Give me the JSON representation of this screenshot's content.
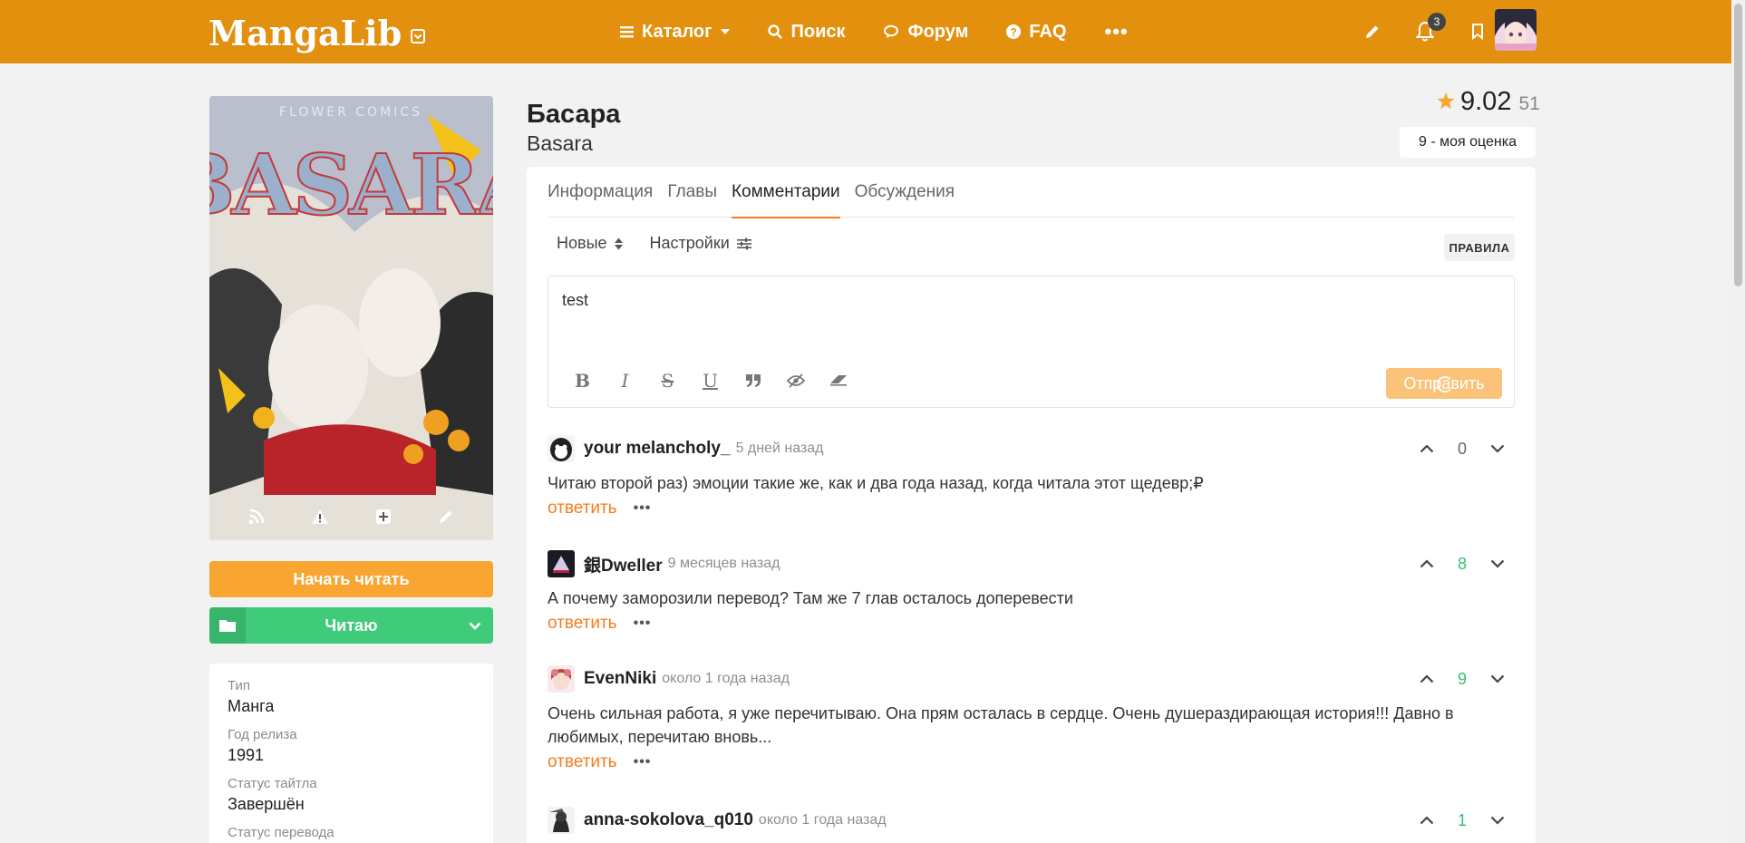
{
  "header": {
    "logo_text": "MangaLib",
    "nav": [
      {
        "label": "Каталог",
        "icon": "menu-icon"
      },
      {
        "label": "Поиск",
        "icon": "search-icon"
      },
      {
        "label": "Форум",
        "icon": "chat-icon"
      },
      {
        "label": "FAQ",
        "icon": "help-icon"
      }
    ],
    "more": "•••",
    "notifications_count": "3"
  },
  "manga": {
    "title_ru": "Басара",
    "title_en": "Basara",
    "rating": "9.02",
    "rating_count": "51",
    "my_rating": "9 - моя оценка",
    "start_reading": "Начать читать",
    "list_status": "Читаю",
    "cover_text": "BASARA"
  },
  "info": [
    {
      "key": "Тип",
      "value": "Манга"
    },
    {
      "key": "Год релиза",
      "value": "1991"
    },
    {
      "key": "Статус тайтла",
      "value": "Завершён"
    },
    {
      "key": "Статус перевода",
      "value": ""
    }
  ],
  "tabs": [
    "Информация",
    "Главы",
    "Комментарии",
    "Обсуждения"
  ],
  "active_tab": "Комментарии",
  "comments_toolbar": {
    "sort_label": "Новые",
    "settings_label": "Настройки",
    "rules_label": "ПРАВИЛА"
  },
  "editor": {
    "text": "test",
    "send_label": "Отправить"
  },
  "comments": [
    {
      "user": "your melancholy_",
      "time": "5 дней назад",
      "text": "Читаю второй раз) эмоции такие же, как и два года назад, когда читала этот щедевр;₽",
      "votes": "0",
      "reply": "ответить"
    },
    {
      "user": "銀Dweller",
      "time": "9 месяцев назад",
      "text": "А почему заморозили перевод? Там же 7 глав осталось доперевести",
      "votes": "8",
      "reply": "ответить"
    },
    {
      "user": "EvenNiki",
      "time": "около 1 года назад",
      "text": "Очень сильная работа, я уже перечитываю. Она прям осталась в сердце. Очень душераздирающая история!!! Давно в любимых, перечитаю вновь...",
      "votes": "9",
      "reply": "ответить"
    },
    {
      "user": "anna-sokolova_q010",
      "time": "около 1 года назад",
      "text": "",
      "votes": "1",
      "reply": ""
    }
  ],
  "colors": {
    "header": "#e4900f",
    "accent": "#f57c1f",
    "read_button": "#f8a531",
    "reading_button": "#40cb7a",
    "positive_votes": "#3bbd6e"
  }
}
